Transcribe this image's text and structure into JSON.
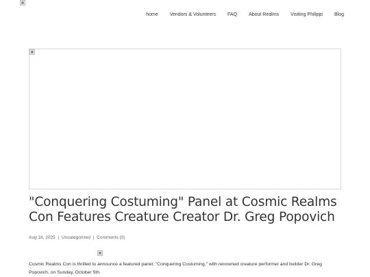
{
  "header": {
    "logo_alt": "",
    "nav": [
      {
        "label": "home"
      },
      {
        "label": "Vendors & Volunteers"
      },
      {
        "label": "FAQ"
      },
      {
        "label": "About Realms"
      },
      {
        "label": "Visiting Philippi"
      },
      {
        "label": "Blog"
      }
    ]
  },
  "post": {
    "title": "\"Conquering Costuming\" Panel at Cosmic Realms Con Features Creature Creator Dr. Greg Popovich",
    "meta": {
      "date": "Aug 18, 2025",
      "sep": "|",
      "category": "Uncategorized",
      "comments": "Comments (0)"
    },
    "body": "Cosmic Realms Con is thrilled to announce a featured panel, \"Conquering Costuming,\" with renowned creature performer and builder Dr. Greg Popovich, on Sunday, October 5th."
  }
}
